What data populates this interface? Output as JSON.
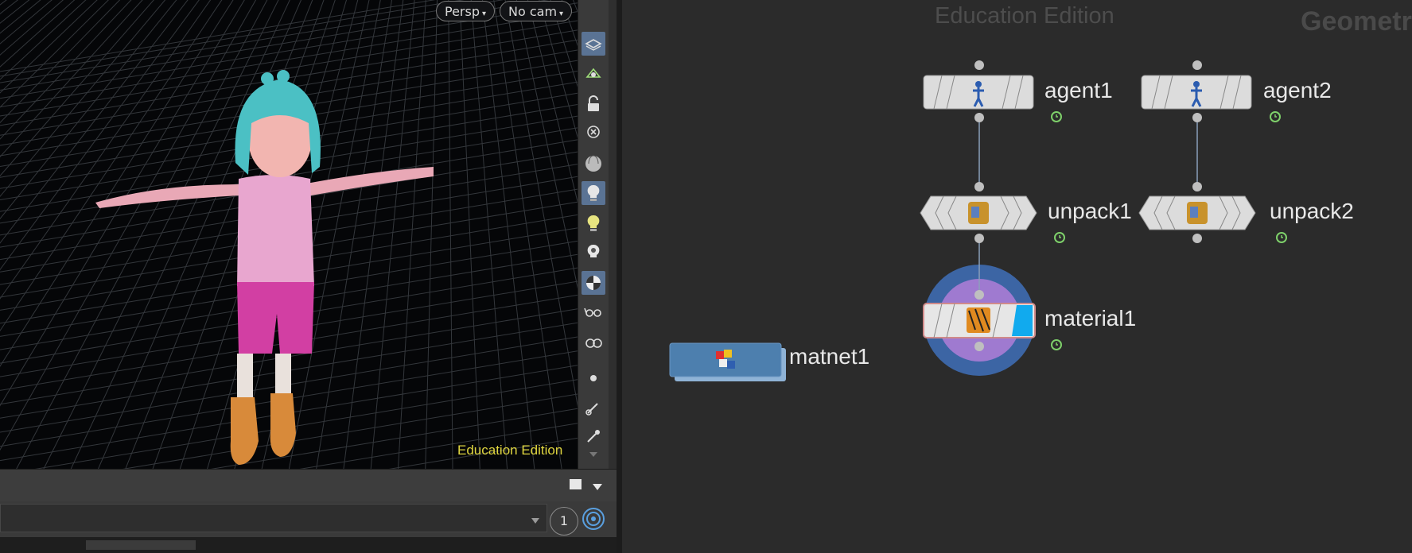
{
  "viewport": {
    "camera_view": "Persp",
    "camera": "No cam",
    "watermark": "Education Edition"
  },
  "toolbar": {
    "icons": [
      "display-options-icon",
      "snap-icon",
      "lock-icon",
      "ghost-close-icon",
      "shading-sphere-icon",
      "headlight-icon",
      "light-bulb-icon",
      "light-add-icon",
      "checker-icon",
      "glasses-icon",
      "camera-eye-icon",
      "dot-icon",
      "brush-icon",
      "dropper-icon"
    ]
  },
  "bottom_panel": {
    "badge": "1"
  },
  "network": {
    "watermark": "Education Edition",
    "context_label": "Geometr",
    "nodes": {
      "agent1": "agent1",
      "agent2": "agent2",
      "unpack1": "unpack1",
      "unpack2": "unpack2",
      "material1": "material1",
      "matnet1": "matnet1"
    },
    "colors": {
      "node_gray": "#dcdcdc",
      "matnet_blue": "#4d7fae",
      "display_flag": "#11aaee",
      "highlight_ring": "#3c65a4",
      "highlight_inner": "#9f7ad0"
    }
  }
}
